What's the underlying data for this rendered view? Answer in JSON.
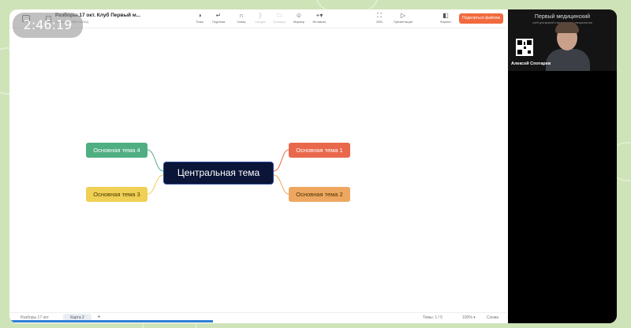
{
  "timer": "2:46:19",
  "document": {
    "title": "Разборы.17 окт. Клуб Первый м...",
    "subtitle": "Ясная · 1 мин назад"
  },
  "toolbar": {
    "items": [
      {
        "id": "theme",
        "icon": "palette-icon",
        "glyph": "◑",
        "label": "Тема"
      },
      {
        "id": "subtopic",
        "icon": "subtopic-icon",
        "glyph": "↵",
        "label": "Подтема"
      },
      {
        "id": "relation",
        "icon": "relation-icon",
        "glyph": "∩",
        "label": "Связь"
      },
      {
        "id": "summary",
        "icon": "summary-icon",
        "glyph": "}",
        "label": "Сводка"
      },
      {
        "id": "boundary",
        "icon": "boundary-icon",
        "glyph": "□",
        "label": "Граница"
      },
      {
        "id": "marker",
        "icon": "marker-icon",
        "glyph": "☺",
        "label": "Маркер"
      },
      {
        "id": "insert",
        "icon": "plus-icon",
        "glyph": "+▾",
        "label": "Вставить"
      },
      {
        "id": "zen",
        "icon": "zen-icon",
        "glyph": "⛶",
        "label": "ZEN"
      },
      {
        "id": "presentation",
        "icon": "play-icon",
        "glyph": "▷",
        "label": "Презентация"
      },
      {
        "id": "format",
        "icon": "format-icon",
        "glyph": "◧",
        "label": "Формат"
      }
    ],
    "share_label": "Поделиться файлом"
  },
  "mindmap": {
    "central": "Центральная тема",
    "topics": [
      {
        "label": "Основная тема 1",
        "color": "#e9684c"
      },
      {
        "label": "Основная тема 2",
        "color": "#eea760"
      },
      {
        "label": "Основная тема 3",
        "color": "#f0cf55"
      },
      {
        "label": "Основная тема 4",
        "color": "#4fae82"
      }
    ]
  },
  "statusbar": {
    "left_label": "Разборы 17 окт",
    "tab_label": "Карта 2",
    "add_label": "+",
    "topics_label": "Темы: 1 / 5",
    "zoom_label": "100% ▾",
    "outline_label": "Схема",
    "progress_percent": 41
  },
  "camera": {
    "title": "Первый медицинский",
    "subtitle": "клуб для врачей и медицинских специалистов",
    "name": "Алексей Спотарев"
  },
  "colors": {
    "accent": "#f26a3d",
    "central_bg": "#0b1537",
    "progress": "#2f7fd4"
  }
}
